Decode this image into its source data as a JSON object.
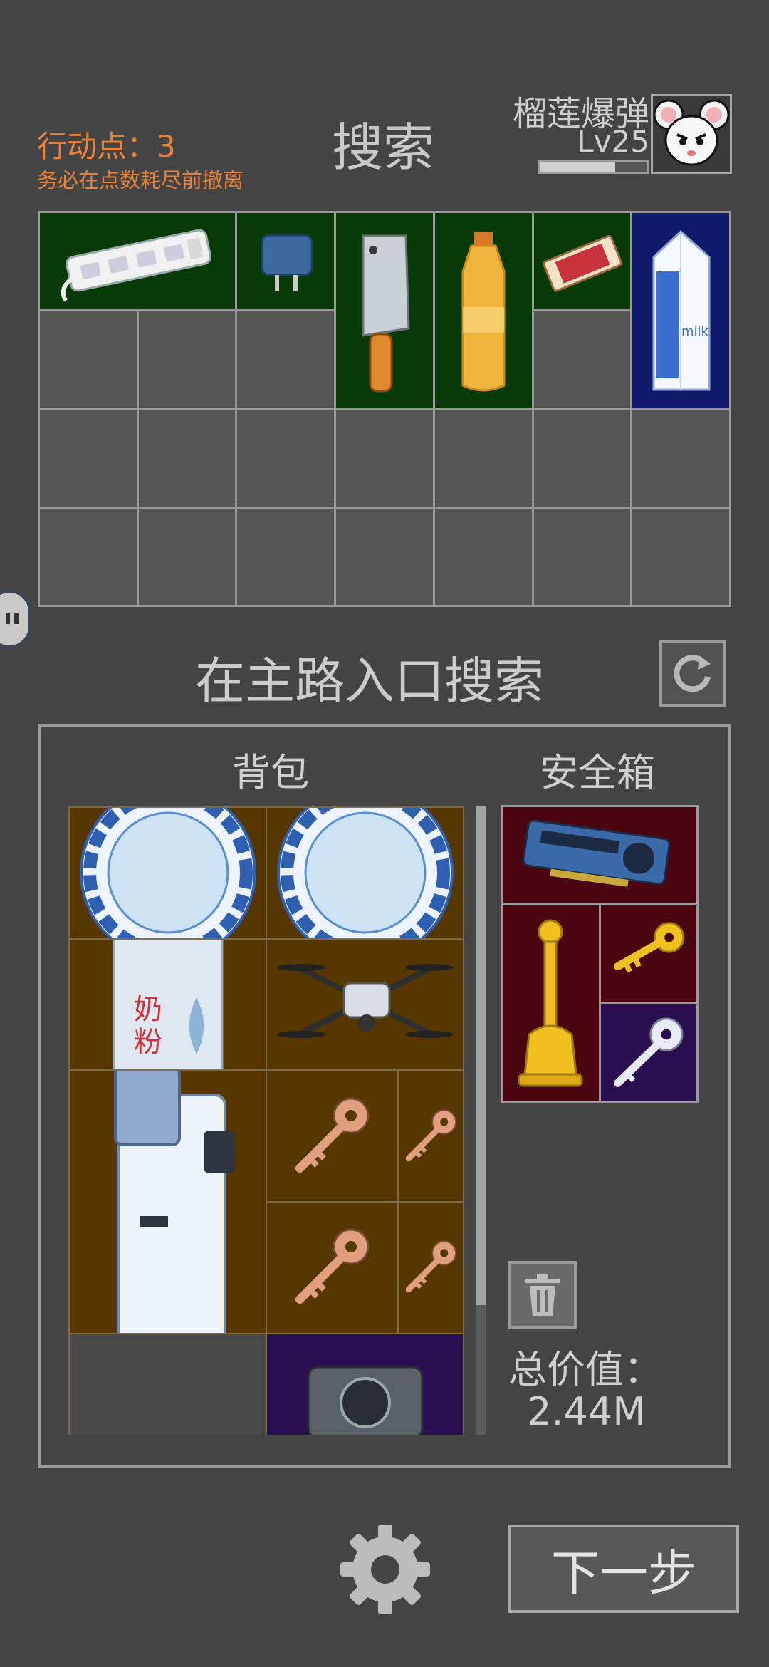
{
  "header": {
    "action_points": "行动点：3",
    "warning": "务必在点数耗尽前撤离",
    "page_title": "搜索",
    "player_name": "榴莲爆弹",
    "player_level": "Lv25",
    "xp_progress": 0.7
  },
  "location": {
    "title": "在主路入口搜索"
  },
  "loot_items": [
    "power-strip",
    "phone-charger",
    "cleaver",
    "oil-bottle",
    "matchbox",
    "milk-carton"
  ],
  "bag": {
    "title": "背包",
    "items": [
      "porcelain-plate",
      "porcelain-plate",
      "milk-powder-can",
      "drone",
      "water-dispenser",
      "bronze-key",
      "bronze-key",
      "bronze-key",
      "bronze-key",
      "camera"
    ]
  },
  "safe_box": {
    "title": "安全箱",
    "items": [
      "graphics-card",
      "golden-trophy",
      "gold-key",
      "silver-key"
    ]
  },
  "summary": {
    "total_label": "总价值：",
    "total_value": "2.44M"
  },
  "buttons": {
    "next": "下一步"
  },
  "colors": {
    "accent_orange": "#e8823a",
    "background": "#444444",
    "common_green": "#083a08",
    "rare_navy": "#0e1a6a",
    "uncommon_brown": "#573700",
    "epic_maroon": "#4a0510",
    "legendary_purple": "#2a0f52"
  }
}
